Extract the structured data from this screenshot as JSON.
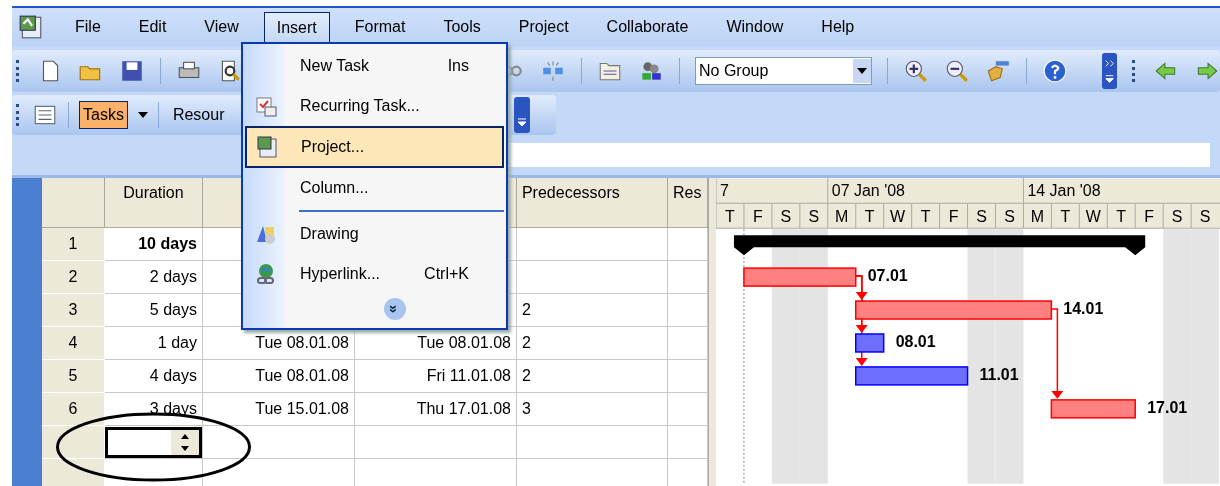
{
  "menubar": [
    {
      "label": "File",
      "selected": false
    },
    {
      "label": "Edit",
      "selected": false
    },
    {
      "label": "View",
      "selected": false
    },
    {
      "label": "Insert",
      "selected": true
    },
    {
      "label": "Format",
      "selected": false
    },
    {
      "label": "Tools",
      "selected": false
    },
    {
      "label": "Project",
      "selected": false
    },
    {
      "label": "Collaborate",
      "selected": false
    },
    {
      "label": "Window",
      "selected": false
    },
    {
      "label": "Help",
      "selected": false
    }
  ],
  "toolbar": {
    "group_select": "No Group"
  },
  "view_bar": {
    "tasks_button": {
      "label": "Tasks",
      "selected": true
    },
    "resources_button": {
      "label": "Resour"
    }
  },
  "insert_menu": [
    {
      "kind": "item",
      "label": "New Task",
      "shortcut": "Ins",
      "selected": false
    },
    {
      "kind": "item",
      "label": "Recurring Task...",
      "selected": false
    },
    {
      "kind": "item",
      "label": "Project...",
      "selected": true
    },
    {
      "kind": "item",
      "label": "Column...",
      "selected": false
    },
    {
      "kind": "separator"
    },
    {
      "kind": "item",
      "label": "Drawing",
      "selected": false
    },
    {
      "kind": "item",
      "label": "Hyperlink...",
      "shortcut": "Ctrl+K",
      "selected": false
    },
    {
      "kind": "expand",
      "label": "»"
    }
  ],
  "table": {
    "columns": {
      "duration": "Duration",
      "predecessors": "Predecessors",
      "column_6": "Res"
    },
    "rows": [
      {
        "id": "1",
        "duration": "10 days",
        "summary": true,
        "editing": false
      },
      {
        "id": "2",
        "duration": "2 days",
        "summary": false,
        "editing": false
      },
      {
        "id": "3",
        "duration": "5 days",
        "predecessors": "2",
        "summary": false,
        "editing": false
      },
      {
        "id": "4",
        "duration": "1 day",
        "start": "Tue 08.01.08",
        "finish": "Tue 08.01.08",
        "predecessors": "2",
        "summary": false,
        "editing": false
      },
      {
        "id": "5",
        "duration": "4 days",
        "start": "Tue 08.01.08",
        "finish": "Fri 11.01.08",
        "predecessors": "2",
        "summary": false,
        "editing": false
      },
      {
        "id": "6",
        "duration": "3 days",
        "start": "Tue 15.01.08",
        "finish": "Thu 17.01.08",
        "predecessors": "3",
        "summary": false,
        "editing": false
      },
      {
        "editing": true
      },
      {
        "editing": false
      }
    ]
  },
  "gantt": {
    "weeks": [
      {
        "label": "7"
      },
      {
        "label": "07 Jan '08"
      },
      {
        "label": "14 Jan '08"
      }
    ],
    "days": [
      {
        "label": "T"
      },
      {
        "label": "F"
      },
      {
        "label": "S",
        "nonworking": true
      },
      {
        "label": "S",
        "nonworking": true
      },
      {
        "label": "M"
      },
      {
        "label": "T"
      },
      {
        "label": "W"
      },
      {
        "label": "T"
      },
      {
        "label": "F"
      },
      {
        "label": "S",
        "nonworking": true
      },
      {
        "label": "S",
        "nonworking": true
      },
      {
        "label": "M"
      },
      {
        "label": "T"
      },
      {
        "label": "W"
      },
      {
        "label": "T"
      },
      {
        "label": "F"
      },
      {
        "label": "S",
        "nonworking": true
      },
      {
        "label": "S",
        "nonworking": true
      }
    ],
    "bars": [
      {
        "kind": "summary"
      },
      {
        "kind": "critical",
        "label": "07.01"
      },
      {
        "kind": "critical",
        "label": "14.01"
      },
      {
        "kind": "normal",
        "label": "08.01"
      },
      {
        "kind": "normal",
        "label": "11.01"
      },
      {
        "kind": "critical",
        "label": "17.01"
      }
    ]
  }
}
